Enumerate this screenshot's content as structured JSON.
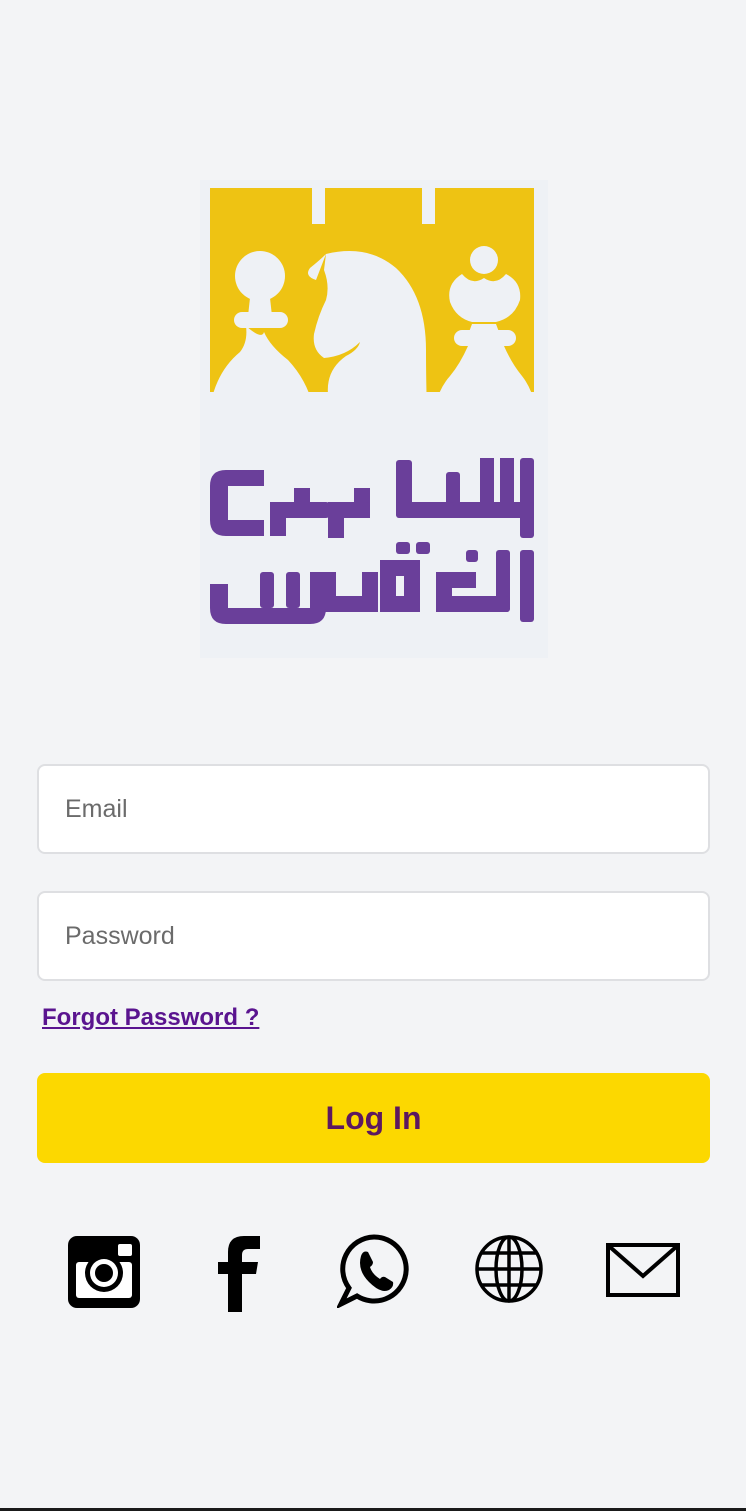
{
  "logo": {
    "brand_text": "شطرنج القدس",
    "colors": {
      "gold": "#eec313",
      "purple": "#6a3f9a",
      "background": "#eef1f5"
    }
  },
  "form": {
    "email_placeholder": "Email",
    "password_placeholder": "Password",
    "forgot_password_label": "Forgot Password ?",
    "login_label": "Log In"
  },
  "social": {
    "items": [
      {
        "icon": "instagram-icon"
      },
      {
        "icon": "facebook-icon"
      },
      {
        "icon": "whatsapp-icon"
      },
      {
        "icon": "globe-icon"
      },
      {
        "icon": "mail-icon"
      }
    ]
  },
  "colors": {
    "page_background": "#f3f4f6",
    "button": "#fcd800",
    "button_text": "#5c1860",
    "link": "#5a148f"
  }
}
